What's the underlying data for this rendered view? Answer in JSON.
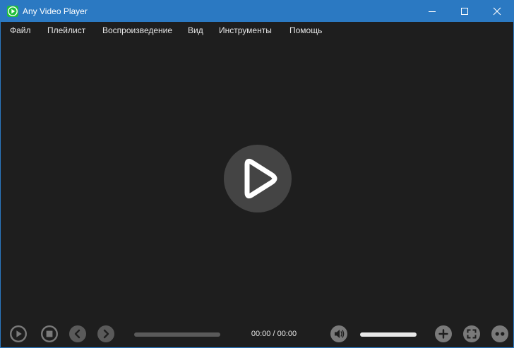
{
  "window": {
    "title": "Any Video Player",
    "accent_color": "#2b79c2",
    "app_icon": "green-play-icon",
    "controls": [
      "minimize-icon",
      "maximize-icon",
      "close-icon"
    ]
  },
  "menu": {
    "items": [
      "Файл",
      "Плейлист",
      "Воспроизведение",
      "Вид",
      "Инструменты",
      "Помощь"
    ]
  },
  "video": {
    "center_icon": "play-icon"
  },
  "controls": {
    "buttons": [
      "play-icon",
      "stop-icon",
      "previous-icon",
      "next-icon",
      "volume-icon",
      "add-icon",
      "fullscreen-icon",
      "more-icon"
    ],
    "time": "00:00 / 00:00",
    "progress": 0,
    "volume": 1.0
  }
}
